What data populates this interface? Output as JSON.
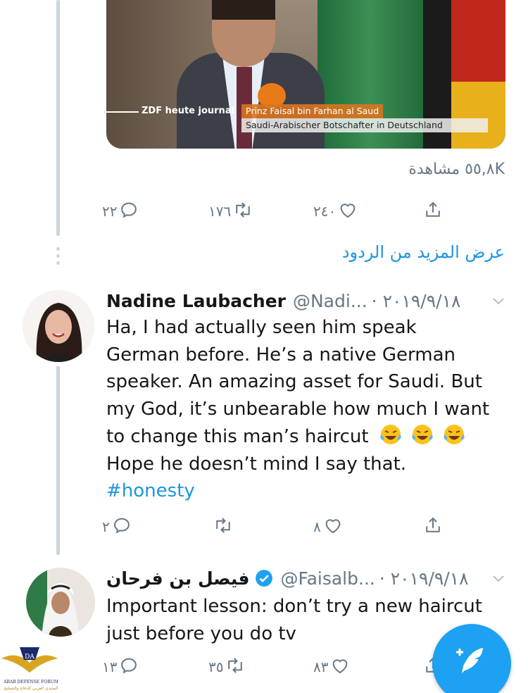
{
  "first_tweet": {
    "video": {
      "brand": "ZDF heute journal",
      "caption_name": "Prinz Faisal bin Farhan al Saud",
      "caption_title": "Saudi-Arabischer Botschafter in Deutschland"
    },
    "views": "٥٥,٨K مشاهدة",
    "reply_count": "٢٢",
    "retweet_count": "١٧٦",
    "like_count": "٢٤٠"
  },
  "show_more_replies": "عرض المزيد من الردود",
  "reply_1": {
    "name": "Nadine Laubacher",
    "handle": "@Nadi...",
    "date": "· ٢٠١٩/٩/١٨",
    "text_lines": [
      "Ha, I had actually seen him speak",
      "German before. He’s a native German",
      "speaker. An amazing asset for Saudi. But",
      "my God, it’s unbearable how much I want",
      "to change this man’s haircut",
      "Hope he doesn’t mind I say that."
    ],
    "hashtag": "#honesty",
    "reply_count": "٢",
    "retweet_count": "",
    "like_count": "٨"
  },
  "reply_2": {
    "name": "فيصل بن فرحان",
    "handle": "@Faisalb...",
    "date": "· ٢٠١٩/٩/١٨",
    "text_lines": [
      "Important lesson: don’t try a new haircut",
      "just before you do tv"
    ],
    "reply_count": "١٣",
    "retweet_count": "٣٥",
    "like_count": "٨٣"
  },
  "watermark": {
    "title": "ARAB DEFENSE FORUM",
    "subtitle": "المنتدى العربي للدفاع والتسليح",
    "mark": "DA"
  },
  "icons": {
    "reply": "reply-icon",
    "retweet": "retweet-icon",
    "like": "like-icon",
    "share": "share-icon",
    "compose": "compose-icon",
    "verified": "verified-icon",
    "more": "chevron-down-icon"
  },
  "colors": {
    "accent": "#1da1f2",
    "link": "#1b95e0",
    "secondary_text": "#657786",
    "thread_line": "#ccd6dd"
  }
}
